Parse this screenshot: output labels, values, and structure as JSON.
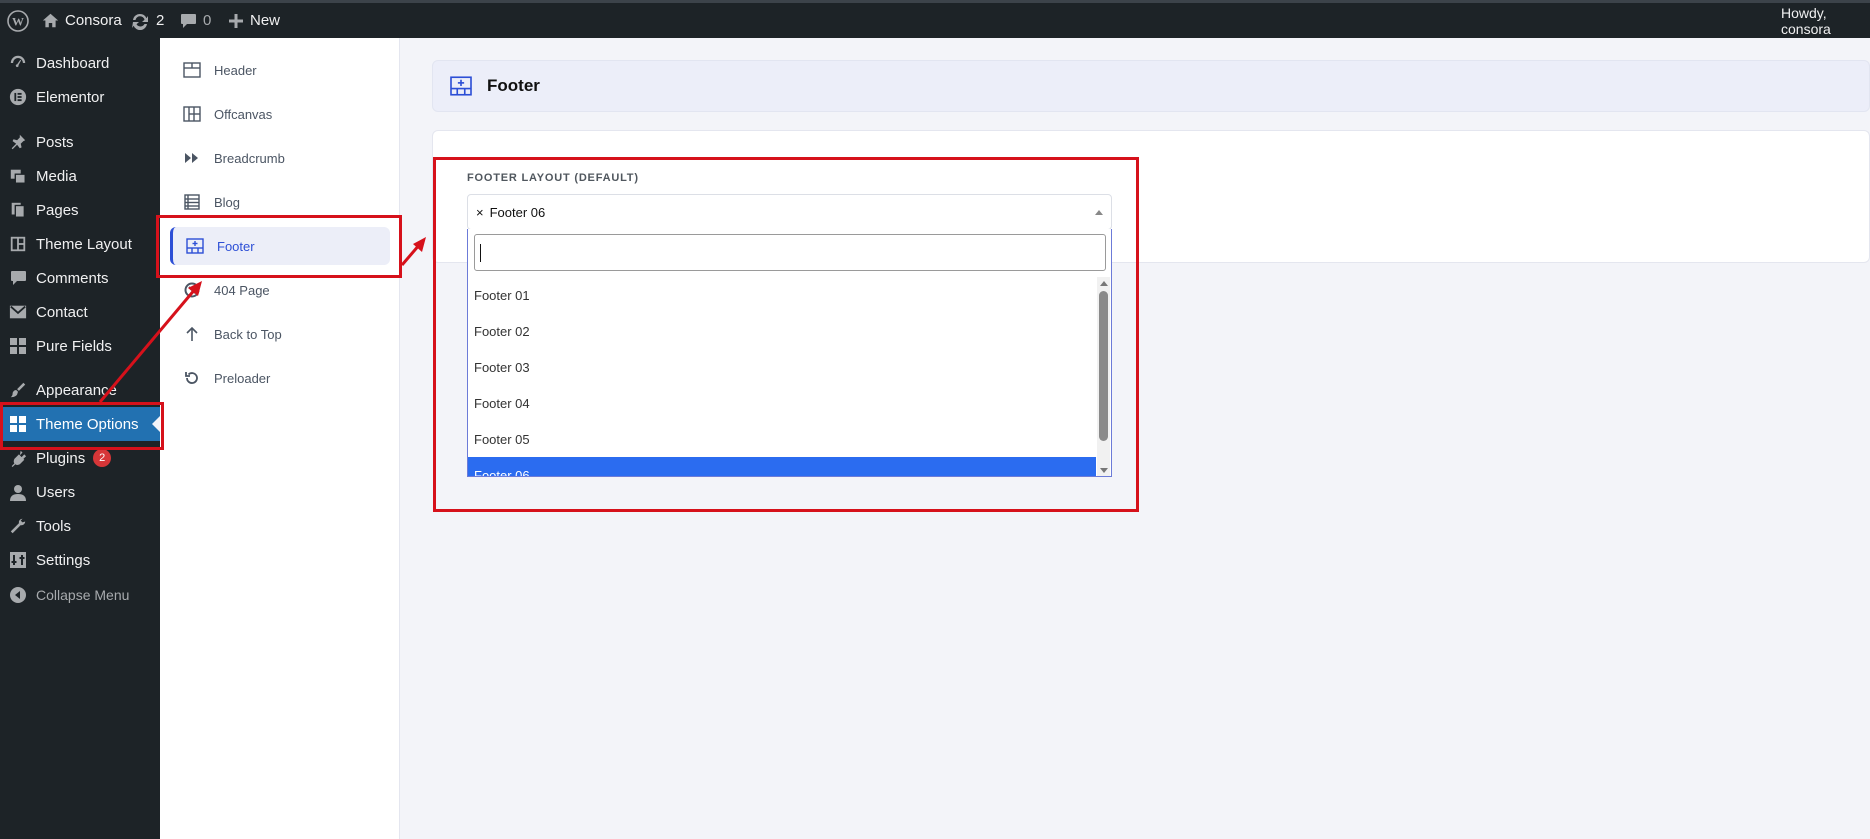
{
  "adminbar": {
    "site_name": "Consora",
    "updates_count": "2",
    "comments_count": "0",
    "new_label": "New",
    "howdy": "Howdy, consora"
  },
  "admin_menu": {
    "items": [
      {
        "label": "Dashboard",
        "icon": "dashboard-icon"
      },
      {
        "label": "Elementor",
        "icon": "elementor-icon"
      },
      {
        "label": "Posts",
        "icon": "pin-icon"
      },
      {
        "label": "Media",
        "icon": "media-icon"
      },
      {
        "label": "Pages",
        "icon": "pages-icon"
      },
      {
        "label": "Theme Layout",
        "icon": "layout-icon"
      },
      {
        "label": "Comments",
        "icon": "comment-icon"
      },
      {
        "label": "Contact",
        "icon": "mail-icon"
      },
      {
        "label": "Pure Fields",
        "icon": "grid-icon"
      },
      {
        "label": "Appearance",
        "icon": "brush-icon"
      },
      {
        "label": "Theme Options",
        "icon": "grid-icon"
      },
      {
        "label": "Plugins",
        "icon": "plugin-icon",
        "badge": "2"
      },
      {
        "label": "Users",
        "icon": "user-icon"
      },
      {
        "label": "Tools",
        "icon": "wrench-icon"
      },
      {
        "label": "Settings",
        "icon": "settings-icon"
      },
      {
        "label": "Collapse Menu",
        "icon": "collapse-icon"
      }
    ]
  },
  "options_nav": {
    "items": [
      {
        "label": "Header",
        "icon": "header-icon"
      },
      {
        "label": "Offcanvas",
        "icon": "offcanvas-icon"
      },
      {
        "label": "Breadcrumb",
        "icon": "breadcrumb-icon"
      },
      {
        "label": "Blog",
        "icon": "blog-icon"
      },
      {
        "label": "Footer",
        "icon": "footer-icon"
      },
      {
        "label": "404 Page",
        "icon": "404-icon"
      },
      {
        "label": "Back to Top",
        "icon": "arrow-up-icon"
      },
      {
        "label": "Preloader",
        "icon": "refresh-icon"
      }
    ],
    "active_index": 4
  },
  "section": {
    "title": "Footer"
  },
  "footer_layout": {
    "label": "FOOTER LAYOUT (DEFAULT)",
    "clear_symbol": "×",
    "selected": "Footer 06",
    "search_value": "",
    "options": [
      "Footer 01",
      "Footer 02",
      "Footer 03",
      "Footer 04",
      "Footer 05",
      "Footer 06"
    ]
  },
  "colors": {
    "admin_bar_bg": "#1d2327",
    "menu_active": "#2271b1",
    "accent": "#2d4fd6",
    "option_highlight": "#2b6cf0",
    "annotation": "#d6111b",
    "badge": "#d63638"
  }
}
